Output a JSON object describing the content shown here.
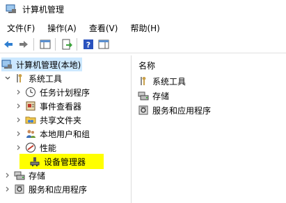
{
  "window": {
    "title": "计算机管理"
  },
  "menu": {
    "file": "文件(F)",
    "action": "操作(A)",
    "view": "查看(V)",
    "help": "帮助(H)"
  },
  "tree": {
    "root": "计算机管理(本地)",
    "system_tools": "系统工具",
    "task_scheduler": "任务计划程序",
    "event_viewer": "事件查看器",
    "shared_folders": "共享文件夹",
    "local_users": "本地用户和组",
    "performance": "性能",
    "device_manager": "设备管理器",
    "storage": "存储",
    "services_apps": "服务和应用程序"
  },
  "right_pane": {
    "column_header": "名称",
    "items": [
      "系统工具",
      "存储",
      "服务和应用程序"
    ]
  },
  "colors": {
    "highlight": "#ffff00",
    "selection": "#cce8ff"
  }
}
